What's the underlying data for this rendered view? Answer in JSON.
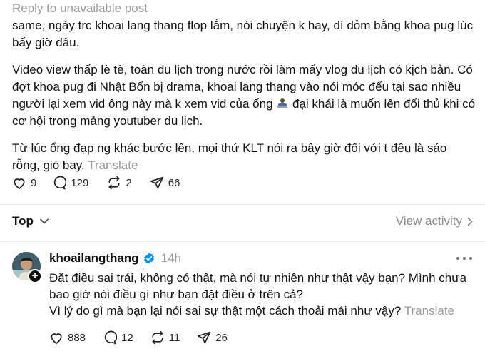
{
  "thread": {
    "reply_context": "Reply to unavailable post",
    "post": {
      "p1": "same, ngày trc khoai lang thang flop lắm, nói chuyện k hay, dí dỏm bằng khoa pug lúc bấy giờ đâu.",
      "p2_a": "Video view thấp lè tè, toàn du lịch trong nước rồi làm mấy vlog du lịch có kịch bản. Có đợt khoa pug đi Nhật Bổn bị drama, khoai lang thang vào nói móc đểu tại sao nhiều người lại xem vid ông này mà k xem vid của ổng",
      "p2_emoji": "man-with-laptop-emoji",
      "p2_b": "đại khái là muốn      lên đối thủ khi có cơ hội trong mảng youtuber du lịch.",
      "p3": "Từ lúc ổng đạp ng khác bước lên, mọi thứ KLT nói ra bây giờ đối với t đều là sáo rỗng, gió bay.",
      "translate": "Translate",
      "likes": "9",
      "comments": "129",
      "reposts": "2",
      "shares": "66"
    },
    "sort": {
      "label": "Top",
      "view_activity": "View activity"
    },
    "reply": {
      "username": "khoailangthang",
      "verified": true,
      "time": "14h",
      "line1": "Đặt điều sai trái, không có thật, mà nói tự nhiên như thật vậy bạn? Mình chưa bao giờ nói điều gì như bạn đặt điều ở trên cả?",
      "line2": "Vì lý do gì mà bạn lại nói sai sự thật một cách thoải mái như vậy?",
      "translate": "Translate",
      "likes": "888",
      "comments": "12",
      "reposts": "11",
      "shares": "26"
    }
  },
  "colors": {
    "text": "#101010",
    "muted": "#9a9a9a",
    "verified_blue": "#0095f6",
    "divider": "#e9e9e9"
  },
  "icons": {
    "like": "heart-outline-icon",
    "comment": "speech-bubble-icon",
    "repost": "repost-arrows-icon",
    "share": "paper-plane-icon",
    "chevron_down": "chevron-down-icon",
    "chevron_right": "chevron-right-icon",
    "verified": "verified-badge-icon",
    "more": "more-dots-icon",
    "follow": "plus-icon"
  }
}
